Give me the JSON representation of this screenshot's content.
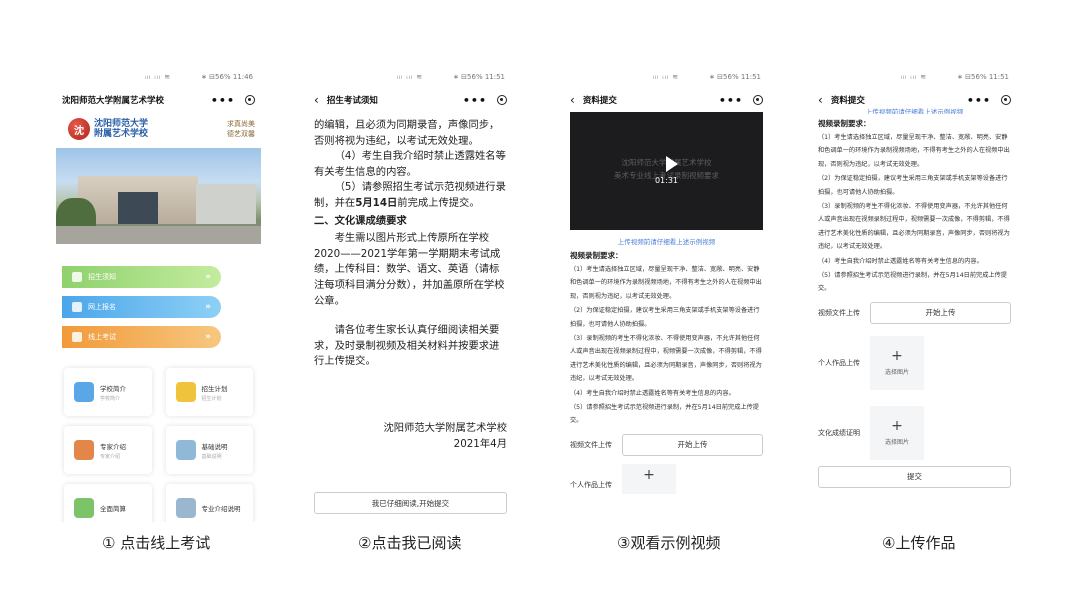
{
  "status": {
    "signal": "ᵢₗₗ ᵢₗₗ ≋",
    "battery_time_1": "∗ ⊟56% 11:46",
    "battery_time_2": "∗ ⊟56% 11:51",
    "battery_time_3": "∗ ⊟56% 11:51",
    "battery_time_4": "∗ ⊟56% 11:51"
  },
  "screen1": {
    "nav_title": "沈阳师范大学附属艺术学校",
    "more": "•••",
    "logo_line1": "沈阳师范大学",
    "logo_line2": "附属艺术学校",
    "slogan_line1": "求真尚美",
    "slogan_line2": "德艺双馨",
    "menu": [
      {
        "label": "招生须知",
        "color": "#8fd16d"
      },
      {
        "label": "网上报名",
        "color": "#4ba6ea"
      },
      {
        "label": "线上考试",
        "color": "#f19a3a"
      }
    ],
    "arrow": "»",
    "cards": [
      {
        "title": "学校简介",
        "sub": "学校简介",
        "color": "#5aa7e8"
      },
      {
        "title": "招生计划",
        "sub": "招生计划",
        "color": "#f0c33c"
      },
      {
        "title": "专家介绍",
        "sub": "专家介绍",
        "color": "#e3864a"
      },
      {
        "title": "基础说明",
        "sub": "基础说明",
        "color": "#8fb9d6"
      },
      {
        "title": "全面简算",
        "sub": "",
        "color": "#7cc46a"
      },
      {
        "title": "专业介绍说明",
        "sub": "",
        "color": "#9bb7cf"
      }
    ]
  },
  "screen2": {
    "nav_title": "招生考试须知",
    "lines": [
      "的编辑，且必须为同期录音，声像同步，",
      "否则将视为违纪，以考试无效处理。",
      "（4）考生自我介绍时禁止透露姓名等有关考生信息的内容。",
      "（5）请参照招生考试示范视频进行录制，并在",
      "5月14日",
      "前完成上传提交。"
    ],
    "heading2": "二、文化课成绩要求",
    "para_culture": "考生需以图片形式上传原所在学校2020——2021学年第一学期期末考试成绩，上传科目：数学、语文、英语（请标注每项科目满分分数），并加盖原所在学校公章。",
    "para_parents": "请各位考生家长认真仔细阅读相关要求，及时录制视频及相关材料并按要求进行上传提交。",
    "sign_school": "沈阳师范大学附属艺术学校",
    "sign_date": "2021年4月",
    "read_button": "我已仔细阅读,开始提交"
  },
  "screen3": {
    "nav_title": "资料提交",
    "video_watermark_1": "沈阳师范大学附属艺术学校",
    "video_watermark_2": "美术专业线上考试录制视频要求",
    "video_time": "01:31",
    "video_link": "上传视频前请仔细看上述示例视频",
    "req_title": "视频录制要求：",
    "reqs": [
      "（1）考生请选择独立区域，尽量呈现干净、整洁、宽敞、明亮、安静和色调单一的环境作为录制视频场地，不得有考生之外的人在视频中出现，否则视为违纪，以考试无效处理。",
      "（2）为保证稳定拍摄，建议考生采用三角支架或手机支架等设备进行拍摄，也可请他人协助拍摄。",
      "（3）录制视频的考生不得化浓妆、不得使用变声器，不允许其他任何人或声音出现在视频录制过程中，视频需要一次成像，不得剪辑，不得进行艺术美化性质的编辑，且必须为同期录音，声像同步，否则将视为违纪，以考试无效处理。",
      "（4）考生自我介绍时禁止透露姓名等有关考生信息的内容。",
      "（5）请参照招生考试示范视频进行录制，并在5月14日前完成上传提交。"
    ],
    "video_label": "视频文件上传",
    "upload_button": "开始上传",
    "works_label": "个人作品上传",
    "plus": "+"
  },
  "screen4": {
    "nav_title": "资料提交",
    "top_cut": "上传视频前请仔细看上述示例视频",
    "req_title": "视频录制要求：",
    "reqs": [
      "（1）考生请选择独立区域，尽量呈现干净、整洁、宽敞、明亮、安静和色调单一的环境作为录制视频场地，不得有考生之外的人在视频中出现，否则视为违纪，以考试无效处理。",
      "（2）为保证稳定拍摄，建议考生采用三角支架或手机支架等设备进行拍摄，也可请他人协助拍摄。",
      "（3）录制视频的考生不得化浓妆、不得使用变声器，不允许其他任何人或声音出现在视频录制过程中，视频需要一次成像，不得剪辑，不得进行艺术美化性质的编辑，且必须为同期录音，声像同步，否则将视为违纪，以考试无效处理。",
      "（4）考生自我介绍时禁止透露姓名等有关考生信息的内容。",
      "（5）请参照招生考试示范视频进行录制，并在5月14日前完成上传提交。"
    ],
    "video_label": "视频文件上传",
    "upload_button": "开始上传",
    "works_label": "个人作品上传",
    "grades_label": "文化成绩证明",
    "plus": "+",
    "choose_image": "选择图片",
    "submit": "提交"
  },
  "captions": [
    "① 点击线上考试",
    "②点击我已阅读",
    "③观看示例视频",
    "④上传作品"
  ]
}
